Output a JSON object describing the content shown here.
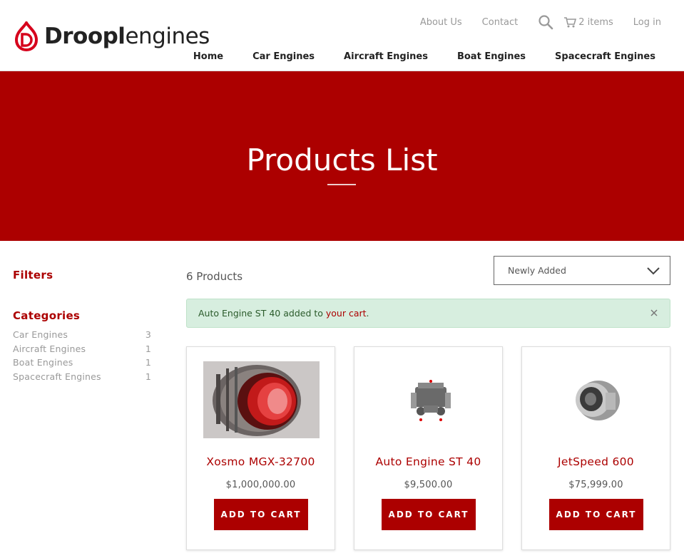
{
  "brand": {
    "name_bold": "Droopl",
    "name_light": "engines",
    "accent_color": "#ac0000"
  },
  "util_nav": {
    "about": "About Us",
    "contact": "Contact",
    "cart_count": "2 items",
    "login": "Log in"
  },
  "main_nav": {
    "items": [
      "Home",
      "Car Engines",
      "Aircraft Engines",
      "Boat Engines",
      "Spacecraft Engines"
    ]
  },
  "hero": {
    "title": "Products List"
  },
  "sidebar": {
    "filters_title": "Filters",
    "categories_title": "Categories",
    "categories": [
      {
        "name": "Car Engines",
        "count": "3"
      },
      {
        "name": "Aircraft Engines",
        "count": "1"
      },
      {
        "name": "Boat Engines",
        "count": "1"
      },
      {
        "name": "Spacecraft Engines",
        "count": "1"
      }
    ]
  },
  "listing": {
    "count_label": "6 Products",
    "sort_selected": "Newly Added"
  },
  "alert": {
    "message_prefix": "Auto Engine ST 40 added to ",
    "link_text": "your cart",
    "message_suffix": "."
  },
  "products": [
    {
      "name": "Xosmo MGX-32700",
      "price": "$1,000,000.00",
      "button": "ADD TO CART"
    },
    {
      "name": "Auto Engine ST 40",
      "price": "$9,500.00",
      "button": "ADD TO CART"
    },
    {
      "name": "JetSpeed 600",
      "price": "$75,999.00",
      "button": "ADD TO CART"
    }
  ]
}
